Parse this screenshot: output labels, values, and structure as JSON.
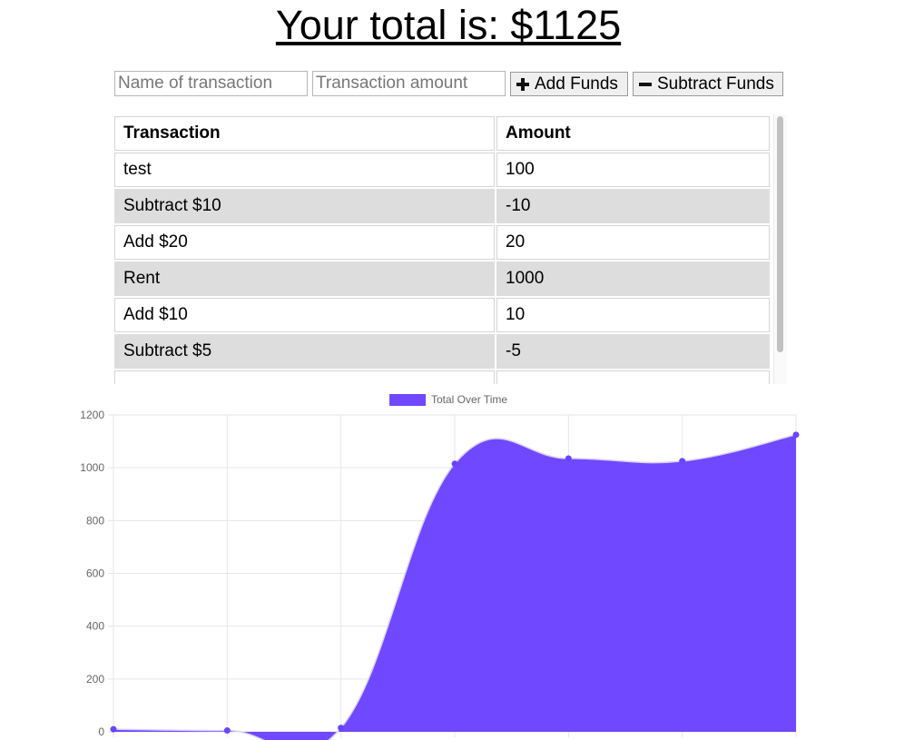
{
  "header": {
    "total_text": "Your total is: $1125"
  },
  "form": {
    "name_placeholder": "Name of transaction",
    "amount_placeholder": "Transaction amount",
    "add_label": "Add Funds",
    "subtract_label": "Subtract Funds"
  },
  "table": {
    "headers": [
      "Transaction",
      "Amount"
    ],
    "rows": [
      [
        "test",
        "100"
      ],
      [
        "Subtract $10",
        "-10"
      ],
      [
        "Add $20",
        "20"
      ],
      [
        "Rent",
        "1000"
      ],
      [
        "Add $10",
        "10"
      ],
      [
        "Subtract $5",
        "-5"
      ]
    ]
  },
  "colors": {
    "series_fill": "#7048ff",
    "series_point": "#6a44ff",
    "grid": "#e6e6e6"
  },
  "chart_data": {
    "type": "area",
    "legend": "top",
    "grid": true,
    "series": [
      {
        "name": "Total Over Time",
        "values": [
          10,
          5,
          15,
          1015,
          1035,
          1025,
          1125
        ]
      }
    ],
    "ylim": [
      0,
      1200
    ],
    "yticks": [
      0,
      200,
      400,
      600,
      800,
      1000,
      1200
    ]
  }
}
